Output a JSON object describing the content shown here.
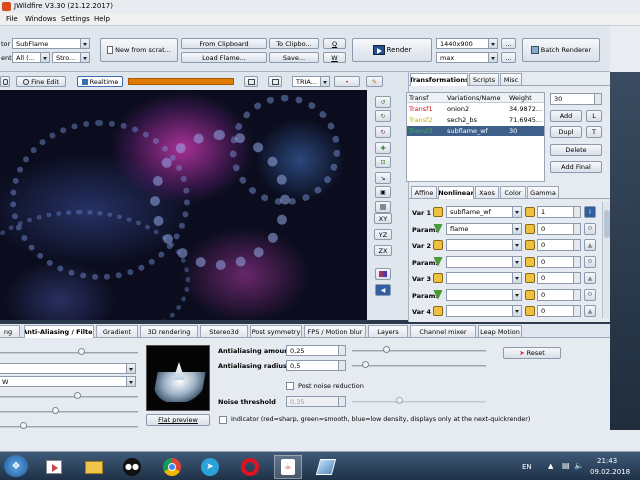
{
  "window": {
    "title": "JWildfire V3.30 (21.12.2017)"
  },
  "menu": [
    "File",
    "Windows",
    "Settings",
    "Help"
  ],
  "toolbar": {
    "editor_label": "tor",
    "editor_value": "SubFlame",
    "gradient_label": "ent",
    "gradient_value": "All (...",
    "stroke_value": "Stro...",
    "new_from_scratch": "New from scrat...",
    "from_clipboard": "From Clipboard",
    "to_clipboard": "To Clipbo...",
    "load_flame": "Load Flame...",
    "save": "Save...",
    "btn_q": "Q",
    "btn_w": "W",
    "render": "Render",
    "resolution": "1440x900",
    "quality": "max",
    "more1": "...",
    "more2": "...",
    "batch_renderer": "Batch Renderer"
  },
  "preview_toolbar": {
    "fine_edit": "Fine Edit",
    "realtime": "Realtime",
    "tria": "TRIA..."
  },
  "side_tools": [
    "XY",
    "YZ",
    "ZX"
  ],
  "panel_tabs": [
    "Transformations",
    "Scripts",
    "Misc"
  ],
  "transforms": {
    "headers": [
      "Transf",
      "Variations/Name",
      "Weight"
    ],
    "rows": [
      {
        "name": "Transf1",
        "variation": "onion2",
        "weight": "34.9872...",
        "color": "#d01010"
      },
      {
        "name": "Transf2",
        "variation": "sech2_bs",
        "weight": "71.6945...",
        "color": "#c0b000"
      },
      {
        "name": "Transf3",
        "variation": "subflame_wf",
        "weight": "30",
        "color": "#2ec02e"
      }
    ],
    "weight_value": "30",
    "add": "Add",
    "l": "L",
    "dupl": "Dupl",
    "t": "T",
    "delete": "Delete",
    "add_final": "Add Final"
  },
  "sub_tabs": [
    "Affine",
    "Nonlinear",
    "Xaos",
    "Color",
    "Gamma"
  ],
  "nonlinear": [
    {
      "label": "Var 1",
      "value": "subflame_wf",
      "amount": "1"
    },
    {
      "label": "Params",
      "value": "flame",
      "amount": "0"
    },
    {
      "label": "Var 2",
      "value": "",
      "amount": "0"
    },
    {
      "label": "Params",
      "value": "",
      "amount": "0"
    },
    {
      "label": "Var 3",
      "value": "",
      "amount": "0"
    },
    {
      "label": "Params",
      "value": "",
      "amount": "0"
    },
    {
      "label": "Var 4",
      "value": "",
      "amount": "0"
    }
  ],
  "bottom_tabs": [
    "ng",
    "Anti-Aliasing / Filter",
    "Gradient",
    "3D rendering",
    "Stereo3d",
    "Post symmetry",
    "FPS / Motion blur",
    "Layers",
    "Channel mixer",
    "Leap Motion"
  ],
  "aa": {
    "left_combo1": "",
    "left_combo2": "W",
    "flat_preview": "Flat preview",
    "amount_label": "Antialiasing amount",
    "amount_value": "0,25",
    "amount_level": 0.25,
    "radius_label": "Antialiasing radius",
    "radius_value": "0,5",
    "radius_level": 0.1,
    "post_noise": "Post noise reduction",
    "noise_label": "Noise threshold",
    "noise_value": "0,35",
    "noise_level": 0.35,
    "indicator": "Indicator (red=sharp, green=smooth, blue=low density, displays only at the next-quickrender)",
    "reset": "Reset"
  },
  "taskbar": {
    "lang": "EN",
    "time": "21:43",
    "date": "09.02.2018"
  },
  "colors": {
    "accent": "#3b6fb0",
    "selected_row": "#3e5f8a",
    "progress": "#e07b00"
  }
}
